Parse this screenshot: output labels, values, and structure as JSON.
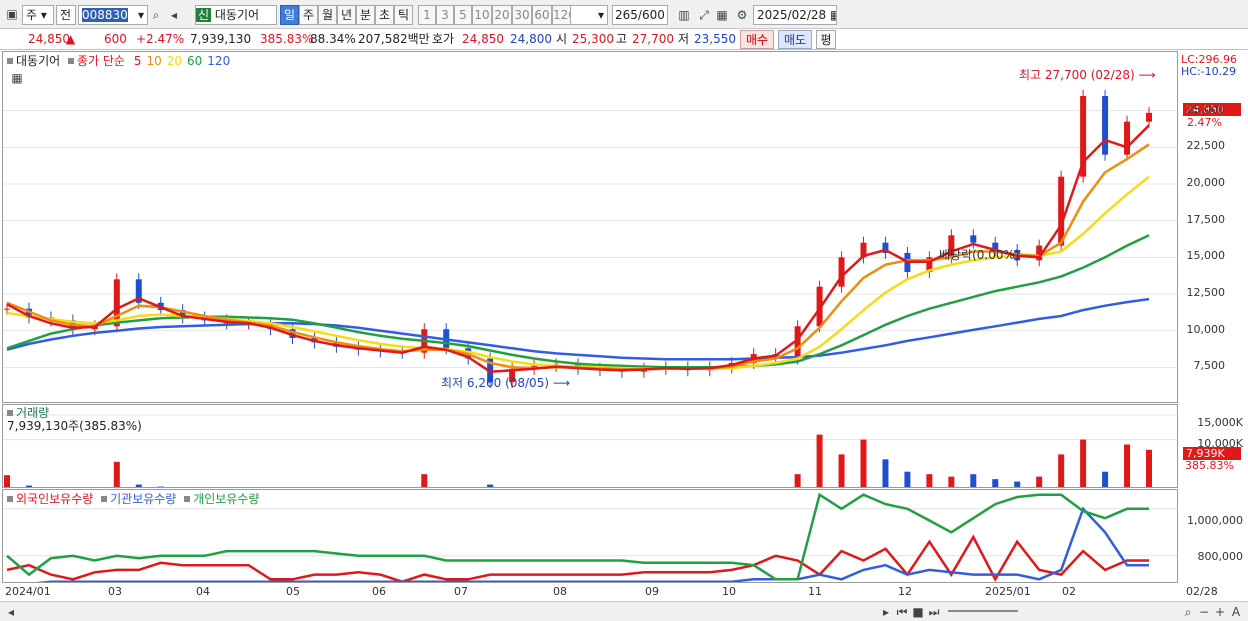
{
  "toolbar": {
    "market": "주",
    "prev": "전",
    "code": "008830",
    "name_prefix": "신",
    "name": "대동기어",
    "periods": [
      "일",
      "주",
      "월",
      "년",
      "분",
      "초",
      "틱"
    ],
    "active_period": "일",
    "minutes": [
      "1",
      "3",
      "5",
      "10",
      "20",
      "30",
      "60",
      "120"
    ],
    "count": "265",
    "count_max": "/600",
    "date": "2025/02/28"
  },
  "quote": {
    "price": "24,850",
    "arrow": "▲",
    "change": "600",
    "change_pct": "+2.47%",
    "volume": "7,939,130",
    "vol_ratio": "385.83%",
    "turnover": "88.34%",
    "amount": "207,582백만",
    "hoga_label": "호가",
    "ask": "24,850",
    "bid": "24,800",
    "open_label": "시",
    "open": "25,300",
    "high_label": "고",
    "high": "27,700",
    "low_label": "저",
    "low": "23,550",
    "buy": "매수",
    "sell": "매도",
    "eval": "평"
  },
  "price_panel": {
    "title": "대동기어",
    "legend_ma": "종가 단순",
    "ma_periods": [
      "5",
      "10",
      "20",
      "60",
      "120"
    ],
    "lc": "LC:296.96",
    "hc": "HC:-10.29",
    "cur_price": "24,850",
    "cur_pct": "2.47%",
    "high_note": "최고 27,700 (02/28)",
    "low_note": "최저 6,260 (08/05)",
    "mid_note": "배당락(0.00%)",
    "y_labels": [
      "25,000",
      "22,500",
      "20,000",
      "17,500",
      "15,000",
      "12,500",
      "10,000",
      "7,500"
    ]
  },
  "volume_panel": {
    "title": "거래량",
    "value": "7,939,130주(385.83%)",
    "y_labels": [
      "15,000K",
      "10,000K"
    ],
    "cur": "7,939K",
    "cur_pct": "385.83%"
  },
  "holding_panel": {
    "series": [
      "외국인보유수량",
      "기관보유수량",
      "개인보유수량"
    ],
    "y_labels": [
      "1,000,000",
      "800,000"
    ]
  },
  "x_axis": {
    "labels": [
      "2024/01",
      "03",
      "04",
      "05",
      "06",
      "07",
      "08",
      "09",
      "10",
      "11",
      "12",
      "2025/01",
      "02",
      "02/28"
    ]
  },
  "colors": {
    "ma5": "#e01818",
    "ma10": "#f08c10",
    "ma20": "#f5dc14",
    "ma60": "#20a040",
    "ma120": "#2f5fe0",
    "up": "#e01818",
    "down": "#1f4fd0"
  },
  "chart_data": [
    {
      "type": "candlestick",
      "title": "대동기어",
      "legend": [
        "종가 단순 5",
        "10",
        "20",
        "60",
        "120"
      ],
      "x": [
        "2024/01",
        "03",
        "04",
        "05",
        "06",
        "07",
        "08",
        "09",
        "10",
        "11",
        "12",
        "2025/01",
        "02",
        "02/28"
      ],
      "ylim": [
        5000,
        29000
      ],
      "close": [
        11500,
        10900,
        10700,
        10100,
        10300,
        13500,
        11900,
        11400,
        10900,
        10700,
        10500,
        10500,
        10100,
        9500,
        9200,
        8900,
        8700,
        8600,
        8500,
        10100,
        8800,
        8100,
        6500,
        7400,
        7600,
        7700,
        7400,
        7300,
        7200,
        7400,
        7500,
        7300,
        7500,
        7800,
        8400,
        8100,
        10300,
        13000,
        15000,
        16000,
        15300,
        14000,
        15000,
        16500,
        16000,
        15500,
        14800,
        15800,
        20500,
        26000,
        22000,
        24250,
        24850
      ],
      "ma5": [
        11800,
        11000,
        10500,
        10200,
        10250,
        11500,
        12200,
        11600,
        11000,
        10800,
        10600,
        10500,
        10200,
        9700,
        9300,
        9000,
        8800,
        8650,
        8500,
        8900,
        8700,
        8200,
        7200,
        7300,
        7400,
        7550,
        7450,
        7350,
        7300,
        7350,
        7450,
        7400,
        7450,
        7650,
        8100,
        8300,
        9400,
        11500,
        13700,
        15100,
        15500,
        14700,
        14700,
        15400,
        15900,
        15500,
        15100,
        15000,
        17200,
        21500,
        23000,
        22500,
        24000
      ],
      "ma10": [
        11900,
        11300,
        10700,
        10400,
        10300,
        11000,
        11700,
        11600,
        11300,
        11000,
        10750,
        10550,
        10350,
        9900,
        9550,
        9200,
        8950,
        8750,
        8600,
        8700,
        8700,
        8400,
        7800,
        7500,
        7450,
        7500,
        7480,
        7420,
        7380,
        7350,
        7400,
        7400,
        7420,
        7550,
        7900,
        8100,
        8800,
        10200,
        12000,
        13600,
        14500,
        14800,
        14800,
        15000,
        15400,
        15400,
        15200,
        15100,
        16000,
        18800,
        20800,
        21700,
        22700
      ],
      "ma20": [
        11200,
        11000,
        10800,
        10600,
        10500,
        10700,
        11000,
        11100,
        11000,
        10950,
        10800,
        10650,
        10500,
        10250,
        9950,
        9650,
        9350,
        9100,
        8900,
        8800,
        8750,
        8550,
        8200,
        7900,
        7700,
        7600,
        7550,
        7500,
        7450,
        7400,
        7400,
        7400,
        7400,
        7450,
        7600,
        7800,
        8100,
        8900,
        10100,
        11400,
        12600,
        13500,
        14100,
        14500,
        14800,
        15000,
        15100,
        15100,
        15400,
        16600,
        18000,
        19300,
        20500
      ],
      "ma60": [
        8800,
        9300,
        9800,
        10100,
        10350,
        10550,
        10700,
        10850,
        10900,
        10950,
        10950,
        10900,
        10850,
        10750,
        10500,
        10200,
        9900,
        9650,
        9450,
        9300,
        9150,
        8950,
        8650,
        8350,
        8100,
        7900,
        7750,
        7650,
        7600,
        7550,
        7500,
        7500,
        7500,
        7520,
        7600,
        7700,
        7900,
        8400,
        9000,
        9700,
        10400,
        11000,
        11500,
        11900,
        12300,
        12700,
        13000,
        13300,
        13700,
        14300,
        15000,
        15800,
        16500
      ],
      "ma120": [
        8700,
        9100,
        9400,
        9650,
        9850,
        10000,
        10150,
        10250,
        10300,
        10350,
        10400,
        10450,
        10500,
        10500,
        10450,
        10350,
        10200,
        10000,
        9800,
        9600,
        9400,
        9200,
        9000,
        8800,
        8600,
        8450,
        8350,
        8250,
        8150,
        8100,
        8050,
        8050,
        8050,
        8050,
        8100,
        8150,
        8200,
        8300,
        8500,
        8750,
        9000,
        9300,
        9550,
        9800,
        10050,
        10300,
        10550,
        10800,
        11000,
        11400,
        11700,
        11950,
        12150
      ]
    },
    {
      "type": "bar",
      "title": "거래량",
      "ylim": [
        0,
        17000
      ],
      "values": [
        2800,
        700,
        400,
        300,
        300,
        5500,
        900,
        500,
        300,
        300,
        200,
        200,
        200,
        300,
        300,
        200,
        200,
        200,
        200,
        3000,
        300,
        200,
        900,
        250,
        200,
        200,
        200,
        200,
        150,
        150,
        150,
        150,
        150,
        200,
        300,
        300,
        3000,
        11000,
        7000,
        10000,
        6000,
        3500,
        3000,
        2500,
        3000,
        2000,
        1500,
        2500,
        7000,
        10000,
        3500,
        9000,
        7939
      ]
    },
    {
      "type": "line",
      "series": [
        {
          "name": "외국인보유수량",
          "values": [
            740,
            760,
            720,
            700,
            730,
            740,
            740,
            770,
            760,
            760,
            760,
            760,
            700,
            700,
            720,
            720,
            730,
            720,
            690,
            720,
            700,
            700,
            720,
            720,
            720,
            720,
            720,
            720,
            720,
            730,
            730,
            730,
            730,
            740,
            760,
            800,
            780,
            720,
            820,
            780,
            830,
            720,
            860,
            720,
            880,
            700,
            860,
            740,
            720,
            820,
            740,
            780,
            780
          ]
        },
        {
          "type": "line",
          "name": "기관보유수량",
          "values": [
            680,
            680,
            690,
            690,
            690,
            690,
            690,
            690,
            690,
            690,
            690,
            690,
            690,
            690,
            690,
            690,
            690,
            690,
            690,
            690,
            690,
            690,
            690,
            690,
            690,
            690,
            690,
            690,
            690,
            690,
            690,
            690,
            690,
            690,
            700,
            700,
            700,
            720,
            700,
            740,
            760,
            720,
            740,
            730,
            720,
            720,
            720,
            700,
            740,
            1000,
            900,
            760,
            760
          ]
        },
        {
          "name": "개인보유수량",
          "values": [
            800,
            720,
            790,
            800,
            780,
            800,
            790,
            800,
            800,
            800,
            820,
            820,
            820,
            820,
            820,
            810,
            800,
            800,
            800,
            800,
            780,
            780,
            780,
            780,
            780,
            780,
            780,
            780,
            780,
            770,
            770,
            770,
            770,
            770,
            760,
            700,
            700,
            1060,
            1000,
            1060,
            1020,
            1000,
            950,
            900,
            960,
            1020,
            1050,
            1060,
            1060,
            990,
            960,
            1000,
            1000
          ]
        }
      ],
      "ylim": [
        680,
        1080
      ]
    }
  ]
}
